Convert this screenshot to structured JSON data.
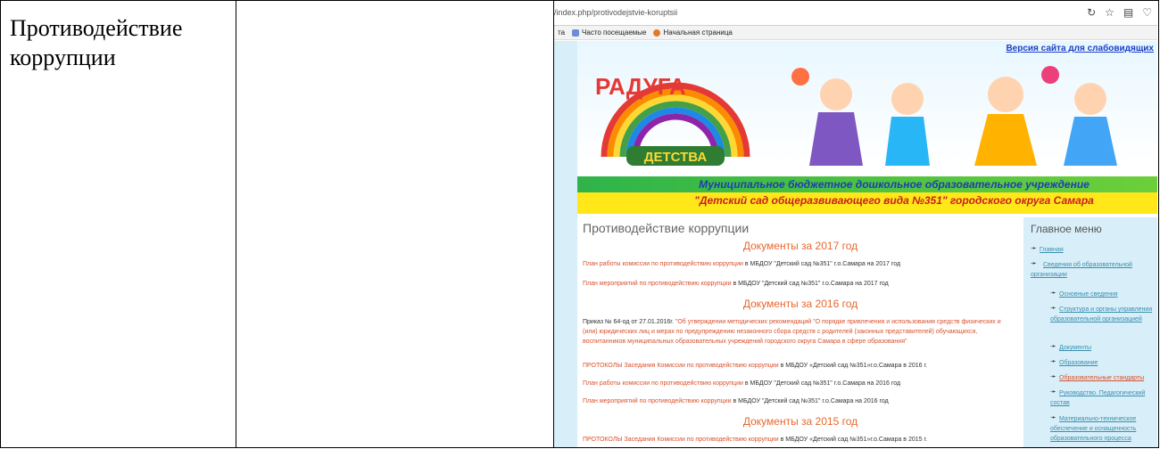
{
  "cell": {
    "title": "Противодействие коррупции"
  },
  "browser": {
    "url": "/index.php/protivodejstvie-koruptsii",
    "bookmarks": [
      "Часто посещаемые",
      "Начальная страница"
    ],
    "bookmark_prefix": "та"
  },
  "site": {
    "version_link": "Версия сайта для слабовидящих",
    "logo_top": "РАДУГА",
    "logo_bottom": "ДЕТСТВА",
    "org_line1": "Муниципальное бюджетное дошкольное образовательное учреждение",
    "org_line2": "\"Детский сад общеразвивающего вида №351\" городского округа Самара",
    "page_title": "Противодействие коррупции",
    "sections": [
      {
        "year": "Документы за 2017 год",
        "items": [
          {
            "link": "План работы комиссии по противодействию коррупции",
            "rest": " в МБДОУ \"Детский сад №351\" г.о.Самара на 2017 год"
          },
          {
            "link": "План мероприятий по противодействию коррупции",
            "rest": " в МБДОУ \"Детский сад №351\" г.о.Самара на 2017 год"
          }
        ]
      },
      {
        "year": "Документы за 2016 год",
        "order_prefix": "Приказ № 64-од от 27.01.2016г. ",
        "order_link": "\"Об утверждении методических рекомендаций \"О порядке привлечения и использования средств физических и (или) юридических лиц и мерах по предупреждению незаконного сбора средств с родителей (законных представителей) обучающихся, воспитанников муниципальных образовательных учреждений городского округа Самара в сфере образования\"",
        "items": [
          {
            "link": "ПРОТОКОЛЫ Заседания Комиссии по противодействию коррупции",
            "rest": " в МБДОУ «Детский сад №351»г.о.Самара в 2016 г."
          },
          {
            "link": "План работы комиссии по противодействию коррупции",
            "rest": " в МБДОУ \"Детский сад №351\" г.о.Самара на 2016 год"
          },
          {
            "link": "План мероприятий по противодействию коррупции",
            "rest": " в МБДОУ \"Детский сад №351\" г.о.Самара на 2016 год"
          }
        ]
      },
      {
        "year": "Документы за 2015 год",
        "items": [
          {
            "link": "ПРОТОКОЛЫ Заседания Комиссии по противодействию коррупции",
            "rest": " в МБДОУ «Детский сад №351»г.о.Самара в 2015 г."
          }
        ]
      }
    ],
    "menu_title": "Главное меню",
    "menu": [
      "Главная",
      "Сведения об образовательной организации",
      "Основные сведения",
      "Структура и органы управления образовательной организацией",
      "Документы",
      "Образование",
      "Образовательные стандарты",
      "Руководство. Педагогический состав",
      "Материально-техническое обеспечение и оснащенность образовательного процесса"
    ]
  },
  "colors": {
    "accent": "#e8672c",
    "link": "#d9502b",
    "menu_link": "#3a8fb0"
  }
}
